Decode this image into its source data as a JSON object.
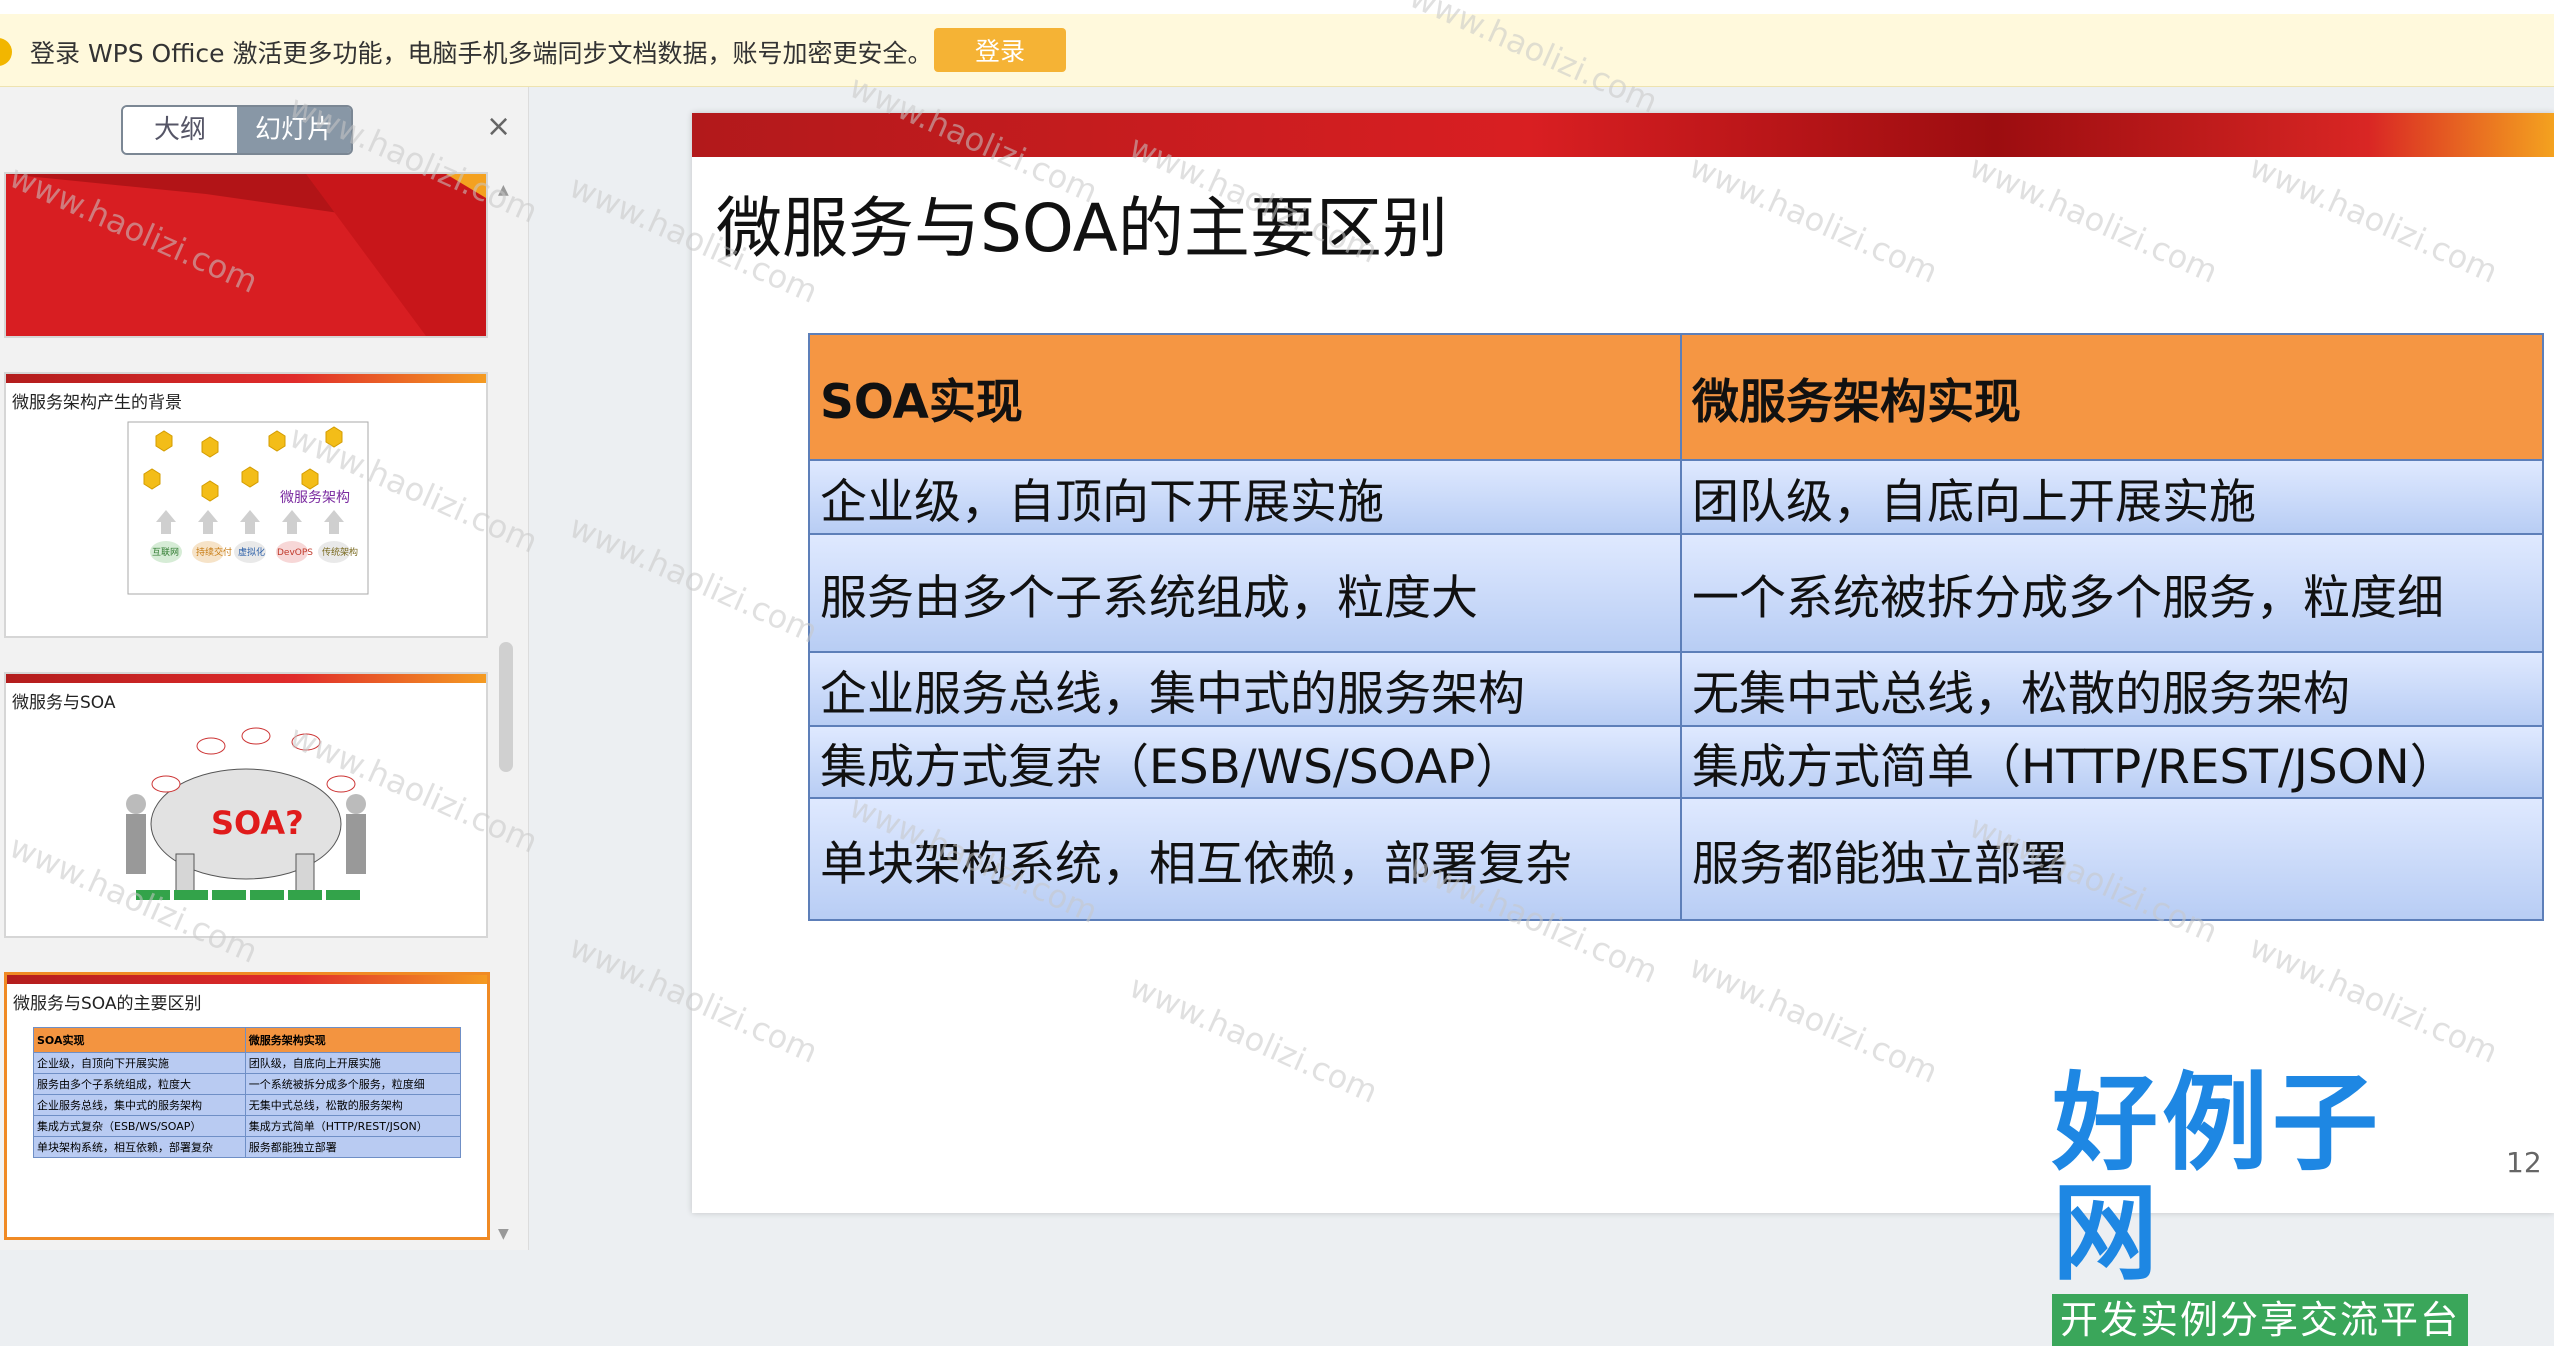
{
  "banner": {
    "message": "登录 WPS Office 激活更多功能，电脑手机多端同步文档数据，账号加密更安全。",
    "login_label": "登录"
  },
  "sidebar": {
    "tabs": [
      {
        "label": "大纲"
      },
      {
        "label": "幻灯片"
      }
    ],
    "close_label": "×",
    "thumbs": [
      {
        "title": ""
      },
      {
        "title": "微服务架构产生的背景",
        "diagram_label": "微服务架构",
        "arrow_labels": [
          "互联网",
          "持续交付",
          "虚拟化",
          "DevOPS",
          "传统架构"
        ]
      },
      {
        "title": "微服务与SOA",
        "image_label": "SOA?"
      },
      {
        "title": "微服务与SOA的主要区别"
      }
    ]
  },
  "slide": {
    "title": "微服务与SOA的主要区别",
    "page_number": "12",
    "table": {
      "headers": [
        "SOA实现",
        "微服务架构实现"
      ],
      "rows": [
        [
          "企业级，自顶向下开展实施",
          "团队级，自底向上开展实施"
        ],
        [
          "服务由多个子系统组成，粒度大",
          "一个系统被拆分成多个服务，粒度细"
        ],
        [
          "企业服务总线，集中式的服务架构",
          "无集中式总线，松散的服务架构"
        ],
        [
          "集成方式复杂（ESB/WS/SOAP）",
          "集成方式简单（HTTP/REST/JSON）"
        ],
        [
          "单块架构系统，相互依赖，部署复杂",
          "服务都能独立部署"
        ]
      ]
    }
  },
  "logo": {
    "main": "好例子网",
    "sub": "开发实例分享交流平台"
  },
  "watermark": "www.haolizi.com",
  "colors": {
    "header_orange": "#f59643",
    "row_blue": "#b8cdf4",
    "banner_bg": "#fff9dc",
    "login_button": "#f5b335",
    "accent_red": "#d91f22"
  }
}
